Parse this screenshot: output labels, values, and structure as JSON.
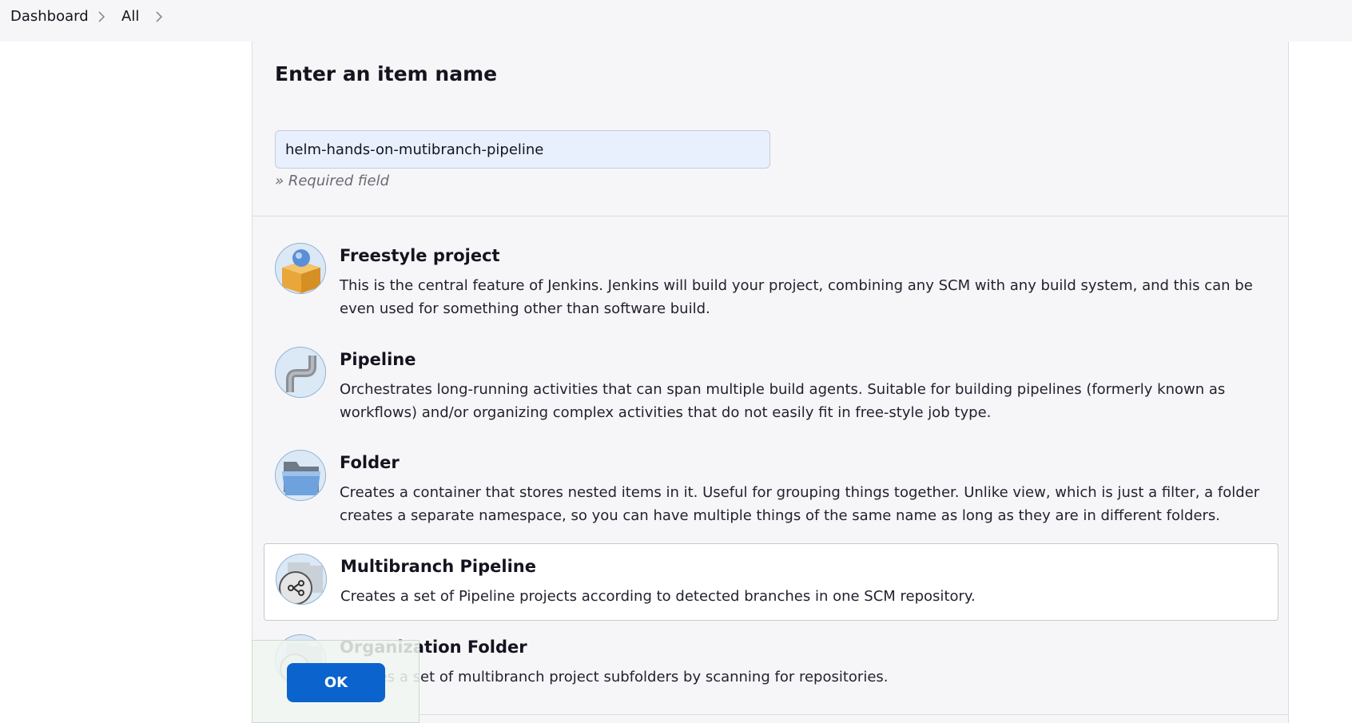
{
  "breadcrumb": {
    "items": [
      "Dashboard",
      "All"
    ]
  },
  "form": {
    "title": "Enter an item name",
    "name_value": "helm-hands-on-mutibranch-pipeline",
    "required_note": "» Required field"
  },
  "items": [
    {
      "title": "Freestyle project",
      "desc": "This is the central feature of Jenkins. Jenkins will build your project, combining any SCM with any build system, and this can be even used for something other than software build.",
      "icon": "freestyle-project-icon"
    },
    {
      "title": "Pipeline",
      "desc": "Orchestrates long-running activities that can span multiple build agents. Suitable for building pipelines (formerly known as workflows) and/or organizing complex activities that do not easily fit in free-style job type.",
      "icon": "pipeline-icon"
    },
    {
      "title": "Folder",
      "desc": "Creates a container that stores nested items in it. Useful for grouping things together. Unlike view, which is just a filter, a folder creates a separate namespace, so you can have multiple things of the same name as long as they are in different folders.",
      "icon": "folder-icon"
    },
    {
      "title": "Multibranch Pipeline",
      "desc": "Creates a set of Pipeline projects according to detected branches in one SCM repository.",
      "icon": "multibranch-pipeline-icon",
      "selected": true
    },
    {
      "title": "Organization Folder",
      "desc": "Creates a set of multibranch project subfolders by scanning for repositories.",
      "icon": "organization-folder-icon"
    }
  ],
  "actions": {
    "ok_label": "OK"
  },
  "colors": {
    "accent": "#0b63ce",
    "panel_bg": "#f6f6f8",
    "input_bg": "#e8f0fe"
  }
}
